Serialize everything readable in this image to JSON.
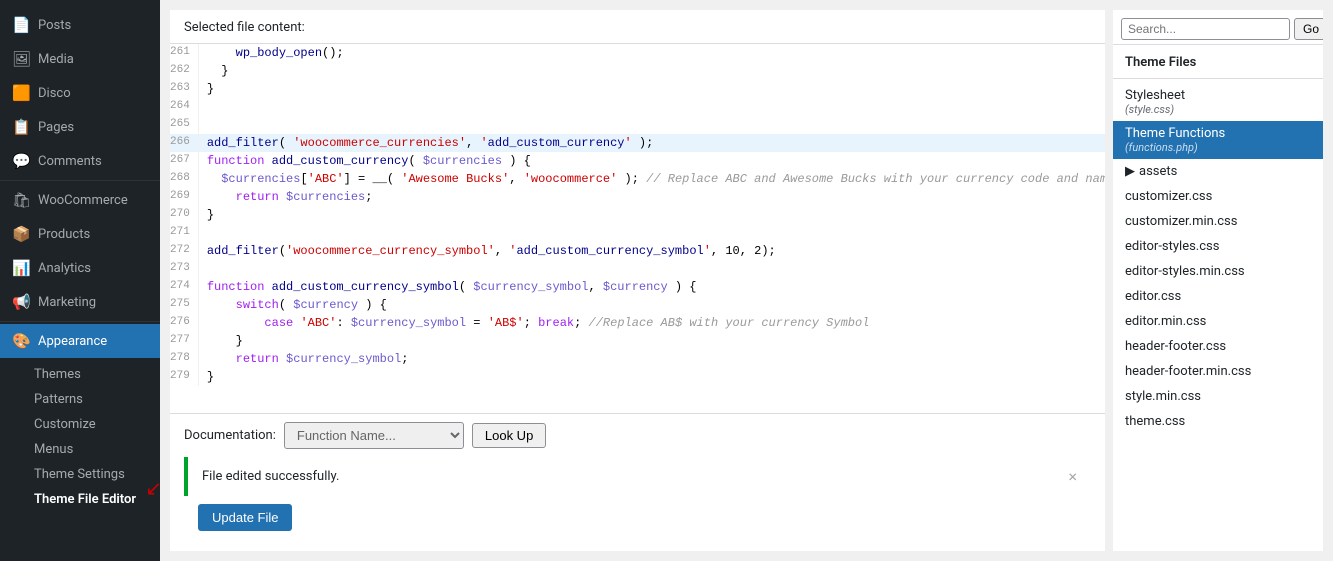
{
  "sidebar": {
    "items": [
      {
        "id": "posts",
        "label": "Posts",
        "icon": "📄",
        "active": false
      },
      {
        "id": "media",
        "label": "Media",
        "icon": "🖼",
        "active": false
      },
      {
        "id": "disco",
        "label": "Disco",
        "icon": "🟧",
        "active": false
      },
      {
        "id": "pages",
        "label": "Pages",
        "icon": "📋",
        "active": false
      },
      {
        "id": "comments",
        "label": "Comments",
        "icon": "💬",
        "active": false
      },
      {
        "id": "woocommerce",
        "label": "WooCommerce",
        "icon": "🛍",
        "active": false
      },
      {
        "id": "products",
        "label": "Products",
        "icon": "📦",
        "active": false
      },
      {
        "id": "analytics",
        "label": "Analytics",
        "icon": "📊",
        "active": false
      },
      {
        "id": "marketing",
        "label": "Marketing",
        "icon": "📢",
        "active": false
      },
      {
        "id": "appearance",
        "label": "Appearance",
        "icon": "🎨",
        "active": true
      }
    ],
    "sub_items": [
      {
        "id": "themes",
        "label": "Themes",
        "active": false
      },
      {
        "id": "patterns",
        "label": "Patterns",
        "active": false
      },
      {
        "id": "customize",
        "label": "Customize",
        "active": false
      },
      {
        "id": "menus",
        "label": "Menus",
        "active": false
      },
      {
        "id": "theme-settings",
        "label": "Theme Settings",
        "active": false
      },
      {
        "id": "theme-file-editor",
        "label": "Theme File Editor",
        "active": true
      }
    ]
  },
  "editor": {
    "header": "Selected file content:",
    "lines": [
      {
        "num": 261,
        "code": "    wp_body_open();",
        "highlight": false
      },
      {
        "num": 262,
        "code": "  }",
        "highlight": false
      },
      {
        "num": 263,
        "code": "}",
        "highlight": false
      },
      {
        "num": 264,
        "code": "",
        "highlight": false
      },
      {
        "num": 265,
        "code": "",
        "highlight": false
      },
      {
        "num": 266,
        "code": "add_filter( 'woocommerce_currencies', 'add_custom_currency' );",
        "highlight": true,
        "type": "filter"
      },
      {
        "num": 267,
        "code": "function add_custom_currency( $currencies ) {",
        "highlight": false,
        "type": "function"
      },
      {
        "num": 268,
        "code": "  $currencies['ABC'] = __( 'Awesome Bucks', 'woocommerce' ); // Replace ABC and Awesome Bucks with your currency code and name",
        "highlight": false,
        "type": "assign"
      },
      {
        "num": 269,
        "code": "    return $currencies;",
        "highlight": false,
        "type": "return"
      },
      {
        "num": 270,
        "code": "}",
        "highlight": false
      },
      {
        "num": 271,
        "code": "",
        "highlight": false
      },
      {
        "num": 272,
        "code": "add_filter('woocommerce_currency_symbol', 'add_custom_currency_symbol', 10, 2);",
        "highlight": false,
        "type": "filter2"
      },
      {
        "num": 273,
        "code": "",
        "highlight": false
      },
      {
        "num": 274,
        "code": "function add_custom_currency_symbol( $currency_symbol, $currency ) {",
        "highlight": false,
        "type": "function2"
      },
      {
        "num": 275,
        "code": "    switch( $currency ) {",
        "highlight": false,
        "type": "switch"
      },
      {
        "num": 276,
        "code": "        case 'ABC': $currency_symbol = 'AB$'; break; //Replace AB$ with your currency Symbol",
        "highlight": false,
        "type": "case"
      },
      {
        "num": 277,
        "code": "    }",
        "highlight": false
      },
      {
        "num": 278,
        "code": "    return $currency_symbol;",
        "highlight": false,
        "type": "return2"
      },
      {
        "num": 279,
        "code": "}",
        "highlight": false
      }
    ]
  },
  "documentation": {
    "label": "Documentation:",
    "placeholder": "Function Name...",
    "lookup_button": "Look Up"
  },
  "success_message": {
    "text": "File edited successfully.",
    "close": "×"
  },
  "update_button": "Update File",
  "theme_files": {
    "header": "Theme Files",
    "stylesheet": {
      "name": "Stylesheet",
      "sub": "(style.css)",
      "active": false
    },
    "theme_functions": {
      "name": "Theme Functions",
      "sub": "(functions.php)",
      "active": true
    },
    "files": [
      {
        "name": "assets",
        "is_folder": true
      },
      {
        "name": "customizer.css",
        "is_folder": false
      },
      {
        "name": "customizer.min.css",
        "is_folder": false
      },
      {
        "name": "editor-styles.css",
        "is_folder": false
      },
      {
        "name": "editor-styles.min.css",
        "is_folder": false
      },
      {
        "name": "editor.css",
        "is_folder": false
      },
      {
        "name": "editor.min.css",
        "is_folder": false
      },
      {
        "name": "header-footer.css",
        "is_folder": false
      },
      {
        "name": "header-footer.min.css",
        "is_folder": false
      },
      {
        "name": "style.min.css",
        "is_folder": false
      },
      {
        "name": "theme.css",
        "is_folder": false
      }
    ]
  }
}
